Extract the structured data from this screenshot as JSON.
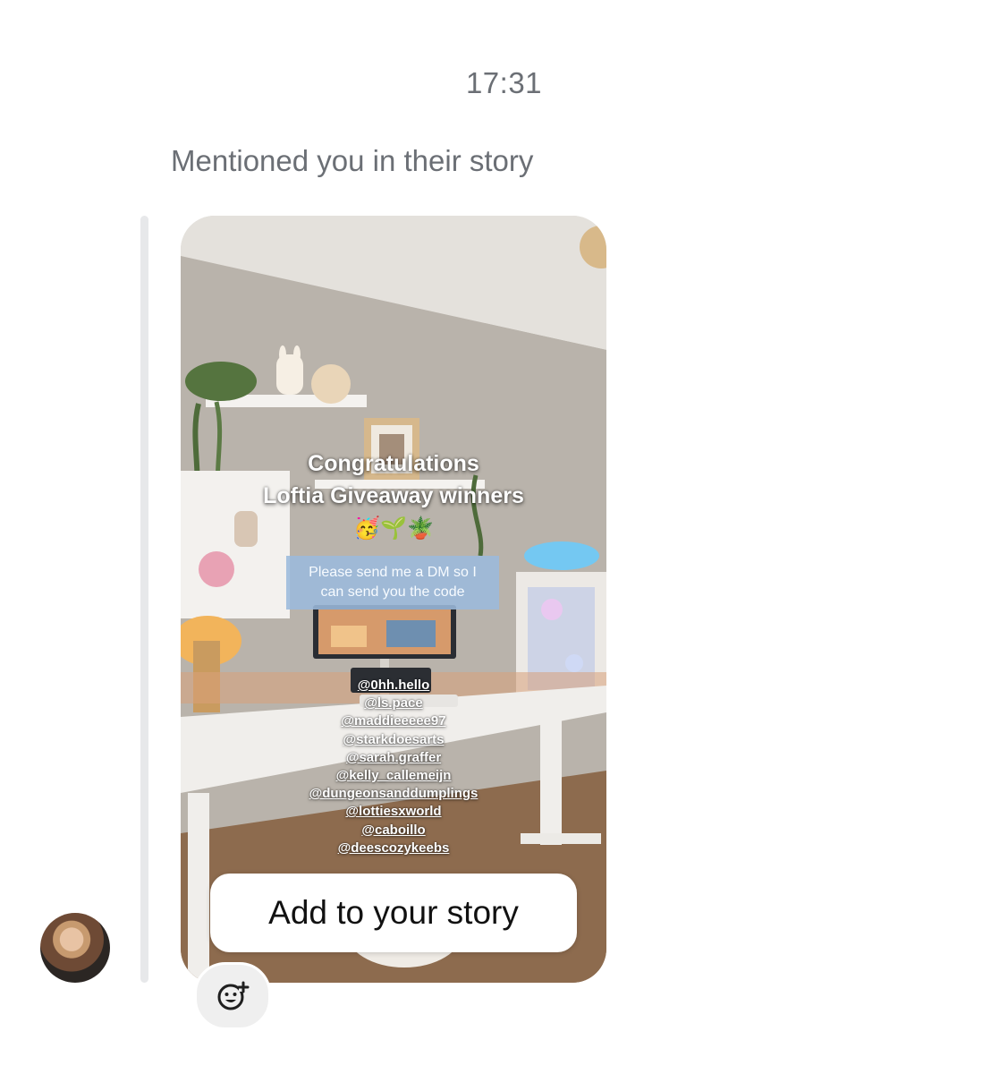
{
  "thread": {
    "timestamp": "17:31",
    "mention_text": "Mentioned you in their story"
  },
  "story": {
    "title_line1": "Congratulations",
    "title_line2": "Loftia Giveaway winners",
    "emojis": "🥳🌱🪴",
    "dm_note_line1": "Please send me a DM so I",
    "dm_note_line2": "can send you the code",
    "mentions": [
      "@0hh.hello",
      "@ls.pace",
      "@maddieeeee97",
      "@starkdoesarts",
      "@sarah.graffer",
      "@kelly_callemeijn",
      "@dungeonsanddumplings",
      "@lottiesxworld",
      "@caboillo",
      "@deescozykeebs"
    ],
    "add_to_story_label": "Add to your story"
  },
  "icons": {
    "avatar": "avatar",
    "react": "add-reaction-icon"
  }
}
